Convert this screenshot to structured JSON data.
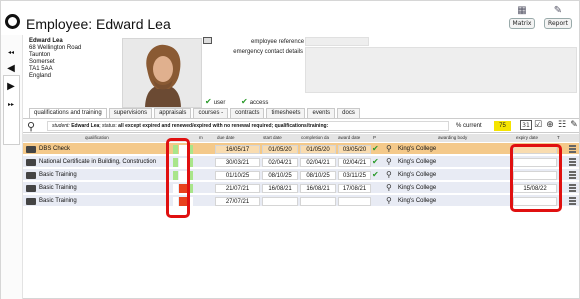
{
  "window": {
    "title": "Employee: Edward Lea"
  },
  "toolbar": {
    "matrix_label": "Matrix",
    "matrix_icon": "calendar-grid-icon",
    "report_label": "Report",
    "report_icon": "pen-list-icon"
  },
  "rail": {
    "first_icon": "double-left-arrow-icon",
    "first_glyph": "◂◂",
    "prev_icon": "left-arrow-icon",
    "prev_glyph": "◀",
    "next_icon": "right-arrow-icon",
    "next_glyph": "▶",
    "last_icon": "double-right-arrow-icon",
    "last_glyph": "▸▸"
  },
  "employee": {
    "name": "Edward Lea",
    "address": [
      "68 Wellington Road",
      "Taunton",
      "Somerset",
      "TA1 5AA",
      "England"
    ],
    "reference_label": "employee reference",
    "reference_value": "",
    "emergency_label": "emergency contact details",
    "emergency_value": "",
    "user_label": "user",
    "access_label": "access"
  },
  "tabs": [
    {
      "label": "qualifications and training",
      "active": true
    },
    {
      "label": "supervisions"
    },
    {
      "label": "appraisals"
    },
    {
      "label": "courses -"
    },
    {
      "label": "contracts"
    },
    {
      "label": "timesheets"
    },
    {
      "label": "events"
    },
    {
      "label": "docs"
    }
  ],
  "filter": {
    "prefix": "student:",
    "name": "Edward Lea",
    "status_prefix": "; status:",
    "status_text": "all except expired and renewed/expired with no renewal required; qualifications/training:",
    "percent_label": "% current",
    "percent_value": "75",
    "calendar_label": "31"
  },
  "table": {
    "headers": {
      "qualification": "qualification",
      "m": "m",
      "due": "due date",
      "start": "start date",
      "completion": "completion da",
      "award": "award date",
      "p": "P",
      "body": "awarding body",
      "expiry": "expiry date",
      "t": "T"
    },
    "rows": [
      {
        "qualification": "DBS Check",
        "due": "16/05/17",
        "start": "01/05/20",
        "completion": "01/05/20",
        "award": "03/05/20",
        "ok": "✔",
        "body": "King's College",
        "expiry": "",
        "status_colors": [
          "#a9e58a",
          "#ffffff",
          "#a9e58a"
        ],
        "highlight": true
      },
      {
        "qualification": "National Certificate in Building, Construction",
        "due": "30/03/21",
        "start": "02/04/21",
        "completion": "02/04/21",
        "award": "02/04/21",
        "ok": "✔",
        "body": "King's College",
        "expiry": "",
        "status_colors": [
          "#a9e58a",
          "#ffffff",
          "#a9e58a"
        ]
      },
      {
        "qualification": "Basic Training",
        "due": "01/10/25",
        "start": "08/10/25",
        "completion": "08/10/25",
        "award": "03/11/25",
        "ok": "✔",
        "body": "King's College",
        "expiry": "",
        "status_colors": [
          "#a9e58a",
          "#ffffff",
          "#a9e58a"
        ]
      },
      {
        "qualification": "Basic Training",
        "due": "21/07/21",
        "start": "16/08/21",
        "completion": "16/08/21",
        "award": "17/08/21",
        "ok": "",
        "body": "King's College",
        "expiry": "15/08/22",
        "status_colors": [
          "#ffffff",
          "#e8401c",
          "#a9e58a"
        ]
      },
      {
        "qualification": "Basic Training",
        "due": "27/07/21",
        "start": "",
        "completion": "",
        "award": "",
        "ok": "",
        "body": "King's College",
        "expiry": "",
        "status_colors": [
          "#ffffff",
          "#e8401c",
          "#ffffff"
        ]
      }
    ]
  },
  "colors": {
    "highlight_row": "#f4c98a",
    "row": "#e8ebf4",
    "annotation": "#e01010",
    "percent_bg": "#f5e400"
  }
}
